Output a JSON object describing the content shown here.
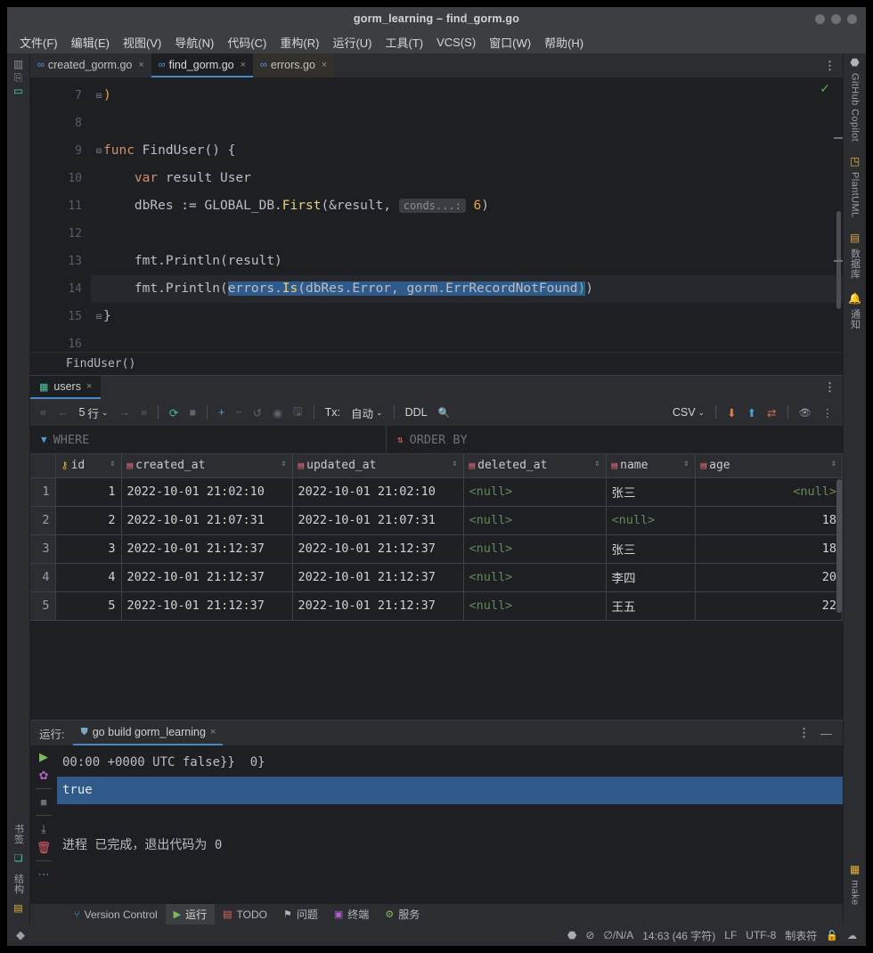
{
  "window": {
    "title": "gorm_learning – find_gorm.go"
  },
  "menubar": [
    {
      "label": "文件(F)"
    },
    {
      "label": "编辑(E)"
    },
    {
      "label": "视图(V)"
    },
    {
      "label": "导航(N)"
    },
    {
      "label": "代码(C)"
    },
    {
      "label": "重构(R)"
    },
    {
      "label": "运行(U)"
    },
    {
      "label": "工具(T)"
    },
    {
      "label": "VCS(S)"
    },
    {
      "label": "窗口(W)"
    },
    {
      "label": "帮助(H)"
    }
  ],
  "left_strip": {
    "top": [
      {
        "label": "项目",
        "icon": "project-icon"
      },
      {
        "label": "",
        "icon": "commit-icon"
      },
      {
        "label": "",
        "icon": "monitor-icon"
      }
    ],
    "bottom": [
      {
        "label": "书签",
        "icon": "bookmarks-icon"
      },
      {
        "label": "结构",
        "icon": "structure-icon"
      }
    ]
  },
  "right_strip": {
    "items": [
      {
        "label": "GitHub Copilot",
        "icon": "copilot-icon"
      },
      {
        "label": "PlantUML",
        "icon": "plantuml-icon"
      },
      {
        "label": "数据库",
        "icon": "database-icon"
      },
      {
        "label": "通知",
        "icon": "bell-icon"
      },
      {
        "label": "make",
        "icon": "make-icon"
      }
    ]
  },
  "editor": {
    "tabs": [
      {
        "label": "created_gorm.go",
        "active": false,
        "close": "×"
      },
      {
        "label": "find_gorm.go",
        "active": true,
        "close": "×"
      },
      {
        "label": "errors.go",
        "active": false,
        "close": "×"
      }
    ],
    "more": "⋮",
    "lines": [
      {
        "no": "7"
      },
      {
        "no": "8"
      },
      {
        "no": "9"
      },
      {
        "no": "10"
      },
      {
        "no": "11"
      },
      {
        "no": "12"
      },
      {
        "no": "13"
      },
      {
        "no": "14"
      },
      {
        "no": "15"
      },
      {
        "no": "16"
      }
    ],
    "code": {
      "l7": ")",
      "l9_kw": "func",
      "l9_name": " FindUser() {",
      "l10_kw": "var",
      "l10_rest": " result User",
      "l11_a": "dbRes := GLOBAL_DB.",
      "l11_fn": "First",
      "l11_b": "(&result, ",
      "l11_hint": "conds...:",
      "l11_num": " 6",
      "l11_c": ")",
      "l13": "fmt.Println(result)",
      "l14_a": "fmt.Println(",
      "l14_sel_a": "errors.",
      "l14_sel_fn": "Is",
      "l14_sel_b": "(dbRes.Error, gorm.ErrRecordNotFound",
      "l14_sel_c": ")",
      "l14_c": ")",
      "l15": "}"
    },
    "breadcrumb": "FindUser()",
    "inspection_ok": "✓",
    "bulb": "💡"
  },
  "db": {
    "tab": {
      "label": "users",
      "close": "×",
      "icon": "table-icon"
    },
    "more": "⋮",
    "toolbar": {
      "first": "«",
      "prev": "←",
      "rows_value": "5",
      "rows_unit": "行",
      "rows_chev": "⌄",
      "next": "→",
      "last": "»",
      "refresh": "⟳",
      "stop": "■",
      "add": "+",
      "remove": "−",
      "revert": "↺",
      "view": "◉",
      "save": "🖫",
      "tx_label": "Tx:",
      "tx_value": "自动",
      "tx_chev": "⌄",
      "ddl": "DDL",
      "search": "🔍",
      "format_value": "CSV",
      "format_chev": "⌄",
      "import": "⬇",
      "export": "⬆",
      "compare": "⇄",
      "eye": "👁",
      "kebab": "⋮"
    },
    "filters": {
      "where_label": "WHERE",
      "where_icon": "filter-icon",
      "order_label": "ORDER BY",
      "order_icon": "sort-icon"
    },
    "columns": [
      {
        "name": "id",
        "icon": "key-icon"
      },
      {
        "name": "created_at",
        "icon": "column-icon"
      },
      {
        "name": "updated_at",
        "icon": "column-icon"
      },
      {
        "name": "deleted_at",
        "icon": "column-index-icon"
      },
      {
        "name": "name",
        "icon": "column-icon"
      },
      {
        "name": "age",
        "icon": "column-icon"
      }
    ],
    "rows": [
      {
        "no": "1",
        "id": "1",
        "created_at": "2022-10-01 21:02:10",
        "updated_at": "2022-10-01 21:02:10",
        "deleted_at": "<null>",
        "name": "张三",
        "age": "<null>"
      },
      {
        "no": "2",
        "id": "2",
        "created_at": "2022-10-01 21:07:31",
        "updated_at": "2022-10-01 21:07:31",
        "deleted_at": "<null>",
        "name": "<null>",
        "age": "18"
      },
      {
        "no": "3",
        "id": "3",
        "created_at": "2022-10-01 21:12:37",
        "updated_at": "2022-10-01 21:12:37",
        "deleted_at": "<null>",
        "name": "张三",
        "age": "18"
      },
      {
        "no": "4",
        "id": "4",
        "created_at": "2022-10-01 21:12:37",
        "updated_at": "2022-10-01 21:12:37",
        "deleted_at": "<null>",
        "name": "李四",
        "age": "20"
      },
      {
        "no": "5",
        "id": "5",
        "created_at": "2022-10-01 21:12:37",
        "updated_at": "2022-10-01 21:12:37",
        "deleted_at": "<null>",
        "name": "王五",
        "age": "22"
      }
    ]
  },
  "run": {
    "label": "运行:",
    "tab": {
      "label": "go build gorm_learning",
      "close": "×"
    },
    "kebab": "⋮",
    "minimize": "—",
    "gutter": {
      "play": "▶",
      "settings": "✿",
      "stop": "■",
      "scroll": "⤓",
      "trash": "🗑",
      "more": "⋯"
    },
    "output": [
      {
        "text": "00:00 +0000 UTC false}}  0}",
        "highlight": false
      },
      {
        "text": "true",
        "highlight": true
      },
      {
        "text": "",
        "highlight": false
      },
      {
        "text": "进程 已完成，退出代码为 0",
        "highlight": false
      }
    ]
  },
  "toolwindows": [
    {
      "label": "Version Control",
      "icon": "branch-icon",
      "active": false
    },
    {
      "label": "运行",
      "icon": "run-icon",
      "active": true
    },
    {
      "label": "TODO",
      "icon": "todo-icon",
      "active": false
    },
    {
      "label": "问题",
      "icon": "problems-icon",
      "active": false
    },
    {
      "label": "终端",
      "icon": "terminal-icon",
      "active": false
    },
    {
      "label": "服务",
      "icon": "services-icon",
      "active": false
    }
  ],
  "statusbar": {
    "left_icon": "ide-logo-icon",
    "right": {
      "copilot": "copilot-icon",
      "nolint": "⊘",
      "coverage": "∅/N/A",
      "caret": "14:63 (46 字符)",
      "line_sep": "LF",
      "encoding": "UTF-8",
      "indent": "制表符",
      "lock": "🔓",
      "cloud": "☁"
    }
  },
  "colors": {
    "accent": "#4a88c7",
    "selection": "#2f5a8a",
    "keyword": "#cf8e6d",
    "function": "#56a8f5",
    "null": "#6a8759",
    "panel": "#2b2d30",
    "editor_bg": "#1e1f22"
  }
}
